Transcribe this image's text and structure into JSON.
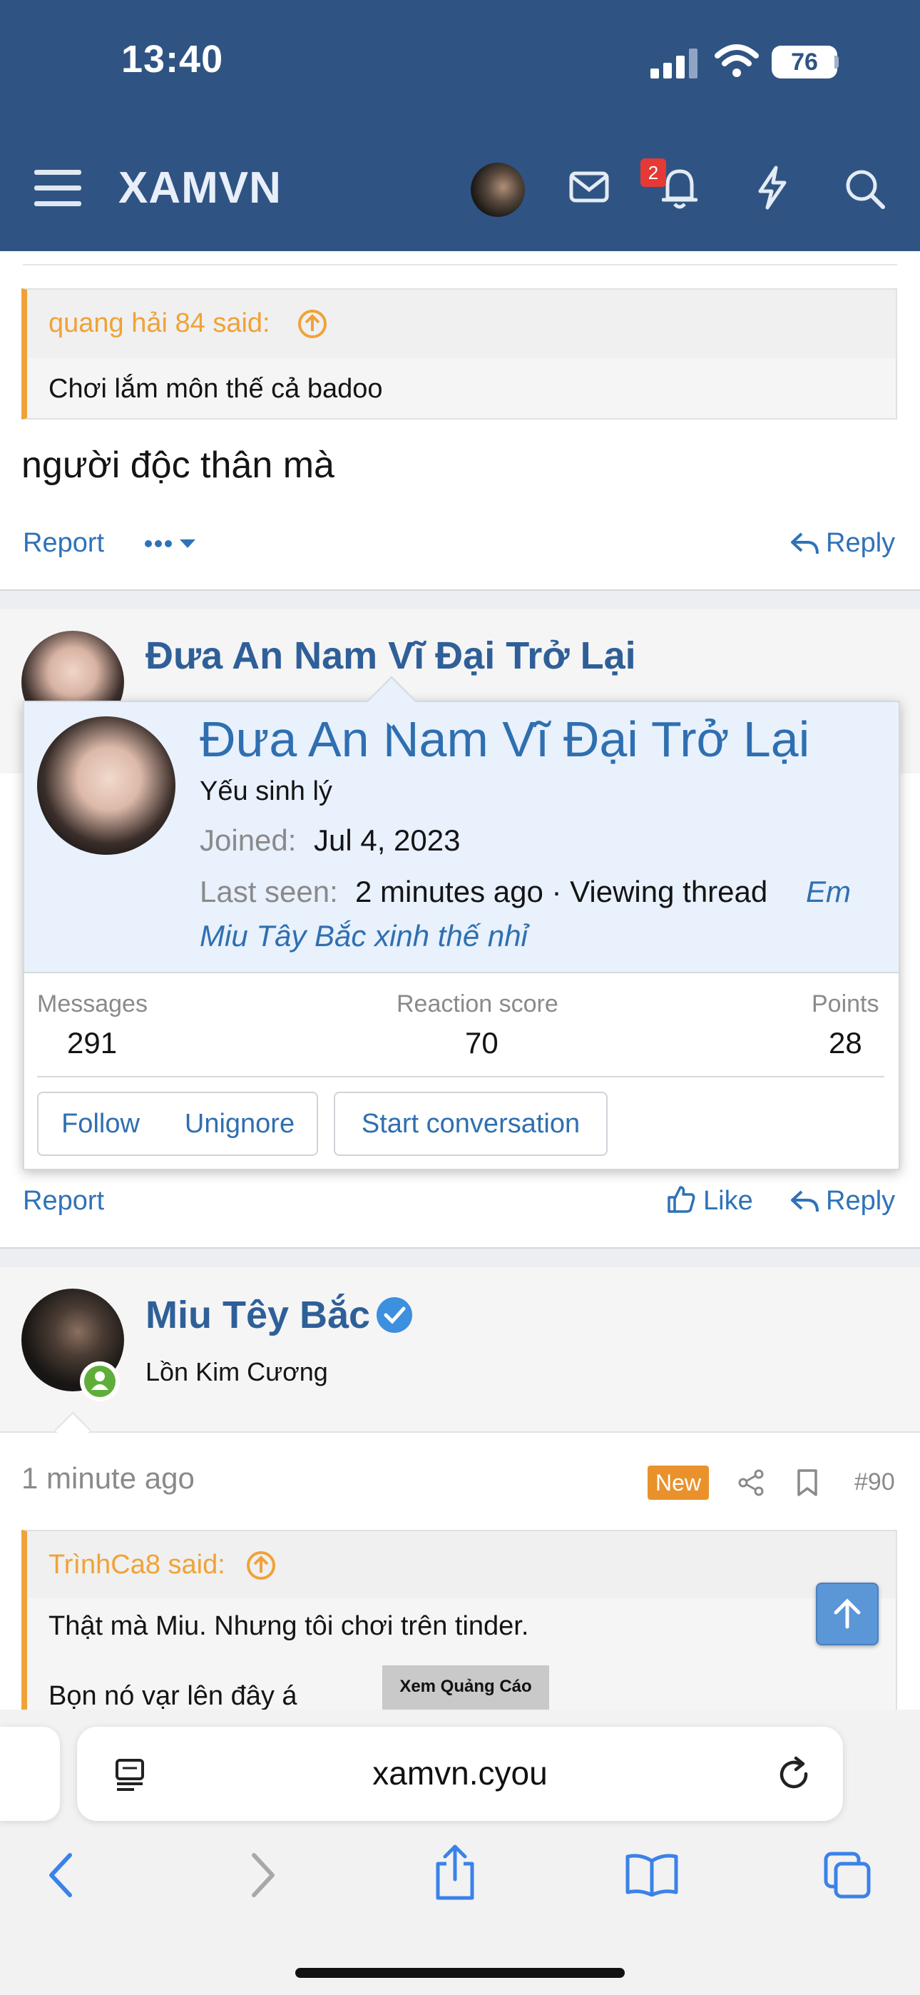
{
  "status": {
    "time": "13:40",
    "battery": "76"
  },
  "header": {
    "logo": "XAMVN",
    "notification_count": "2"
  },
  "post1": {
    "quote_author": "quang hải 84 said:",
    "quote_text": "Chơi lắm môn thế cả badoo",
    "message": "người độc thân mà",
    "report": "Report",
    "reply": "Reply"
  },
  "post2": {
    "username": "Đưa An Nam Vĩ Đại Trở Lại",
    "report": "Report",
    "like": "Like",
    "reply": "Reply"
  },
  "popup": {
    "name": "Đưa An Nam Vĩ Đại Trở Lại",
    "title": "Yếu sinh lý",
    "joined_label": "Joined:",
    "joined_value": "Jul 4, 2023",
    "last_seen_label": "Last seen:",
    "last_seen_value": "2 minutes ago · Viewing thread",
    "thread_line1": "Em",
    "thread_line2": "Miu Tây Bắc xinh thế nhỉ",
    "stats": [
      {
        "label": "Messages",
        "value": "291"
      },
      {
        "label": "Reaction score",
        "value": "70"
      },
      {
        "label": "Points",
        "value": "28"
      }
    ],
    "follow": "Follow",
    "unignore": "Unignore",
    "start_conversation": "Start conversation"
  },
  "post3": {
    "username": "Miu Têy Bắc",
    "user_title": "Lồn Kim Cương",
    "time": "1 minute ago",
    "new_badge": "New",
    "post_number": "#90",
    "quote_author": "TrìnhCa8 said:",
    "quote_line1": "Thật mà Miu. Nhưng tôi chơi trên tinder.",
    "quote_line2": "Bọn nó vạr lên đây á",
    "ad_label": "Xem Quảng Cáo"
  },
  "browser": {
    "url": "xamvn.cyou"
  },
  "colors": {
    "header": "#2f5483",
    "accent": "#f0a238",
    "link": "#2f72b8"
  }
}
